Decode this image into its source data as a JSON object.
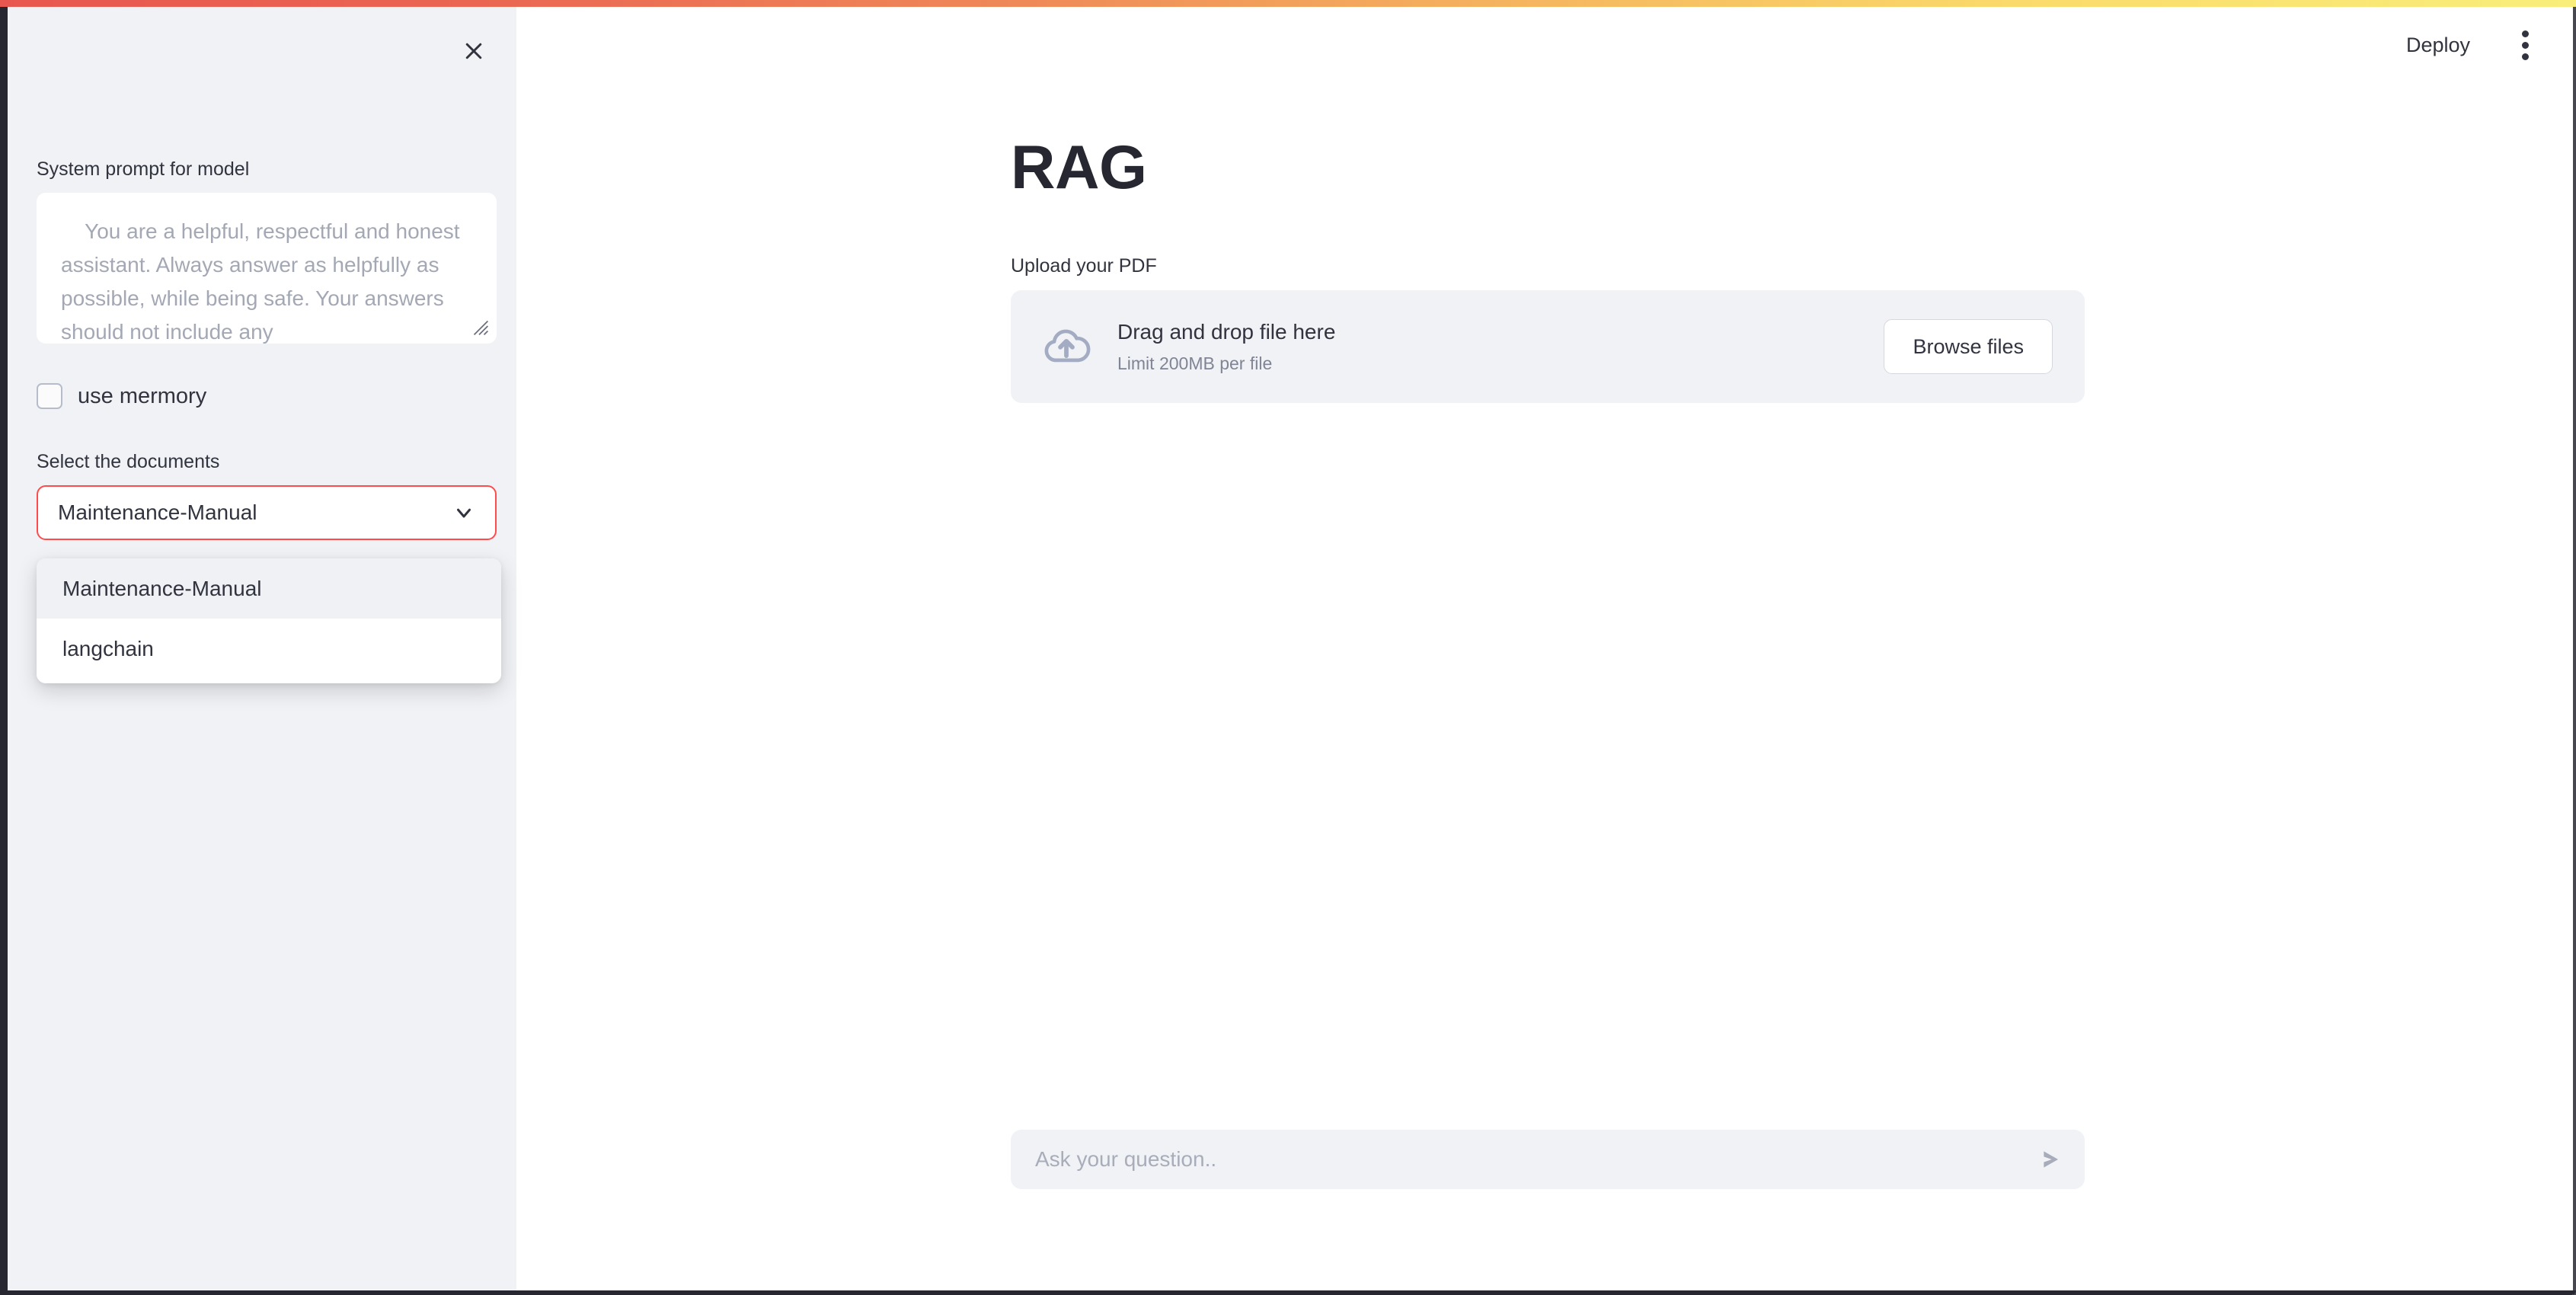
{
  "window": {
    "accent_color": "#ff4b4b",
    "sidebar_bg": "#f0f2f6",
    "frame_color": "#262730",
    "gradient_start": "#e8574f",
    "gradient_end": "#f9ee7a"
  },
  "header": {
    "deploy_label": "Deploy",
    "menu_icon": "kebab-menu-icon"
  },
  "sidebar": {
    "close_icon": "close-icon",
    "system_prompt": {
      "label": "System prompt for model",
      "value": "    You are a helpful, respectful and honest assistant. Always answer as helpfully as possible, while being safe. Your answers should not include any"
    },
    "memory_checkbox": {
      "label": "use mermory",
      "checked": false
    },
    "documents_select": {
      "label": "Select the documents",
      "value": "Maintenance-Manual",
      "expanded": true,
      "chevron_icon": "chevron-down-icon",
      "options": [
        {
          "label": "Maintenance-Manual",
          "selected": true
        },
        {
          "label": "langchain",
          "selected": false
        }
      ]
    }
  },
  "main": {
    "title": "RAG",
    "upload": {
      "label": "Upload your PDF",
      "icon": "cloud-upload-icon",
      "drop_title": "Drag and drop file here",
      "drop_limit": "Limit 200MB per file",
      "browse_label": "Browse files"
    },
    "chat": {
      "placeholder": "Ask your question..",
      "send_icon": "send-icon"
    }
  }
}
